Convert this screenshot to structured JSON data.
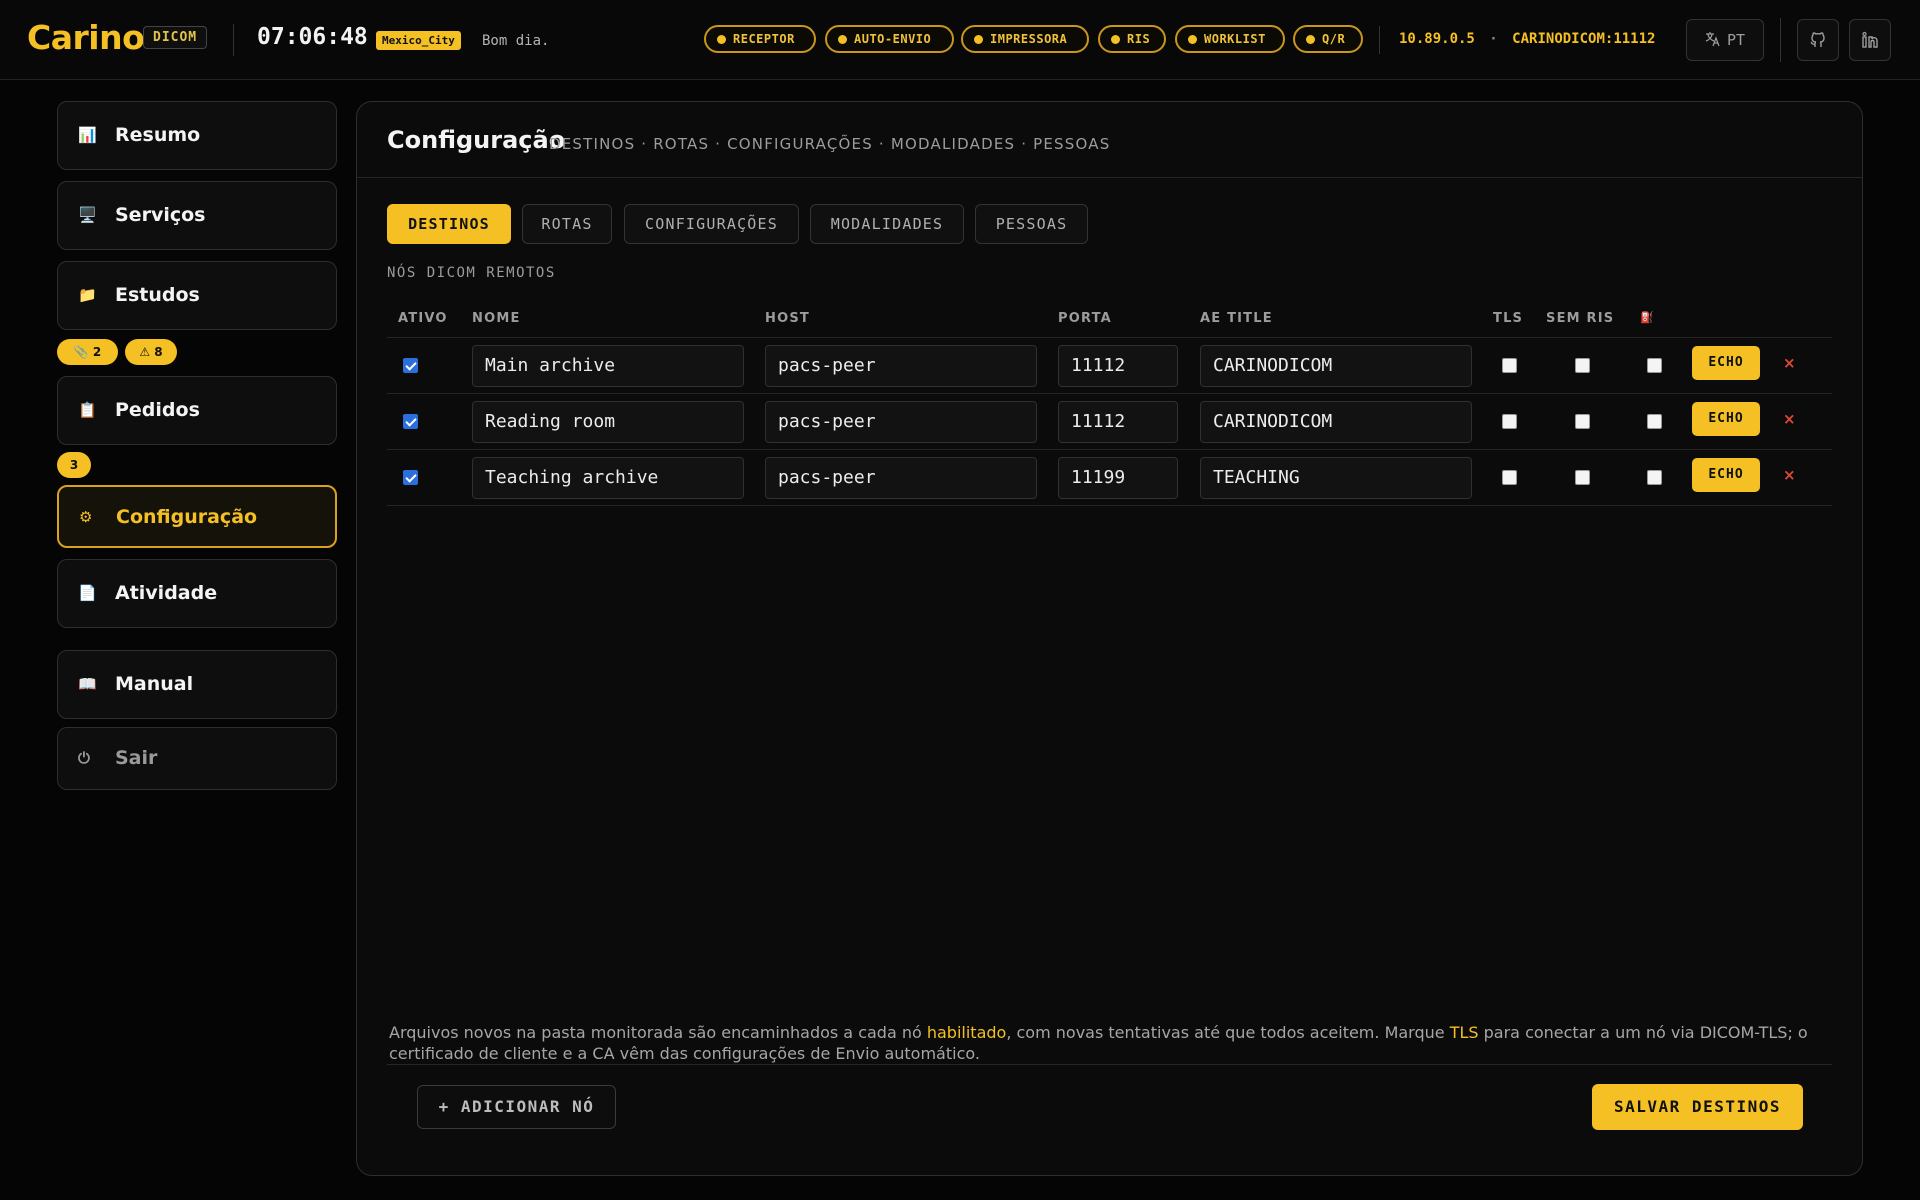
{
  "header": {
    "logo": "Carino",
    "tag": "DICOM",
    "clock": "07:06:48",
    "timezone": "Mexico_City",
    "greeting": "Bom dia.",
    "status_pills": [
      "RECEPTOR",
      "AUTO-ENVIO",
      "IMPRESSORA",
      "RIS",
      "WORKLIST",
      "Q/R"
    ],
    "ip": "10.89.0.5",
    "separator": "·",
    "ae_port": "CARINODICOM:11112",
    "language": "PT",
    "language_icon": "translate-icon",
    "github_icon": "github-icon",
    "linkedin_icon": "linkedin-icon"
  },
  "sidebar": {
    "items": [
      {
        "label": "Resumo",
        "icon": "📊"
      },
      {
        "label": "Serviços",
        "icon": "🖥️"
      },
      {
        "label": "Estudos",
        "icon": "📁"
      },
      {
        "label": "Pedidos",
        "icon": "📋"
      },
      {
        "label": "Configuração",
        "icon": "⚙"
      },
      {
        "label": "Atividade",
        "icon": "📄"
      },
      {
        "label": "Manual",
        "icon": "📖"
      },
      {
        "label": "Sair",
        "icon": "⏻"
      }
    ],
    "study_badges": [
      {
        "icon": "📎",
        "count": "2"
      },
      {
        "icon": "⚠",
        "count": "8"
      }
    ],
    "orders_badge": "3"
  },
  "main": {
    "title": "Configuração",
    "subtitle": "DESTINOS · ROTAS · CONFIGURAÇÕES · MODALIDADES · PESSOAS",
    "tabs": [
      "DESTINOS",
      "ROTAS",
      "CONFIGURAÇÕES",
      "MODALIDADES",
      "PESSOAS"
    ],
    "active_tab": "DESTINOS",
    "section_label": "NÓS DICOM REMOTOS",
    "columns": [
      "ATIVO",
      "NOME",
      "HOST",
      "PORTA",
      "AE TITLE",
      "TLS",
      "SEM RIS",
      "⛽"
    ],
    "rows": [
      {
        "active": true,
        "name": "Main archive",
        "host": "pacs-peer",
        "port": "11112",
        "ae_title": "CARINODICOM",
        "tls": false,
        "no_ris": false,
        "extra": false
      },
      {
        "active": true,
        "name": "Reading room",
        "host": "pacs-peer",
        "port": "11112",
        "ae_title": "CARINODICOM",
        "tls": false,
        "no_ris": false,
        "extra": false
      },
      {
        "active": true,
        "name": "Teaching archive",
        "host": "pacs-peer",
        "port": "11199",
        "ae_title": "TEACHING",
        "tls": false,
        "no_ris": false,
        "extra": false
      }
    ],
    "echo_label": "ECHO",
    "delete_symbol": "×",
    "note": {
      "part1": "Arquivos novos na pasta monitorada são encaminhados a cada nó ",
      "hl1": "habilitado",
      "part2": ", com novas tentativas até que todos aceitem. Marque ",
      "hl2": "TLS",
      "part3": " para conectar a um nó via DICOM-TLS; o certificado de cliente e a CA vêm das configurações de Envio automático."
    },
    "add_button": "+ ADICIONAR NÓ",
    "save_button": "SALVAR DESTINOS"
  },
  "colors": {
    "accent": "#f4c023",
    "background": "#050505",
    "danger": "#e2473a",
    "checkbox": "#2b6fdf"
  }
}
